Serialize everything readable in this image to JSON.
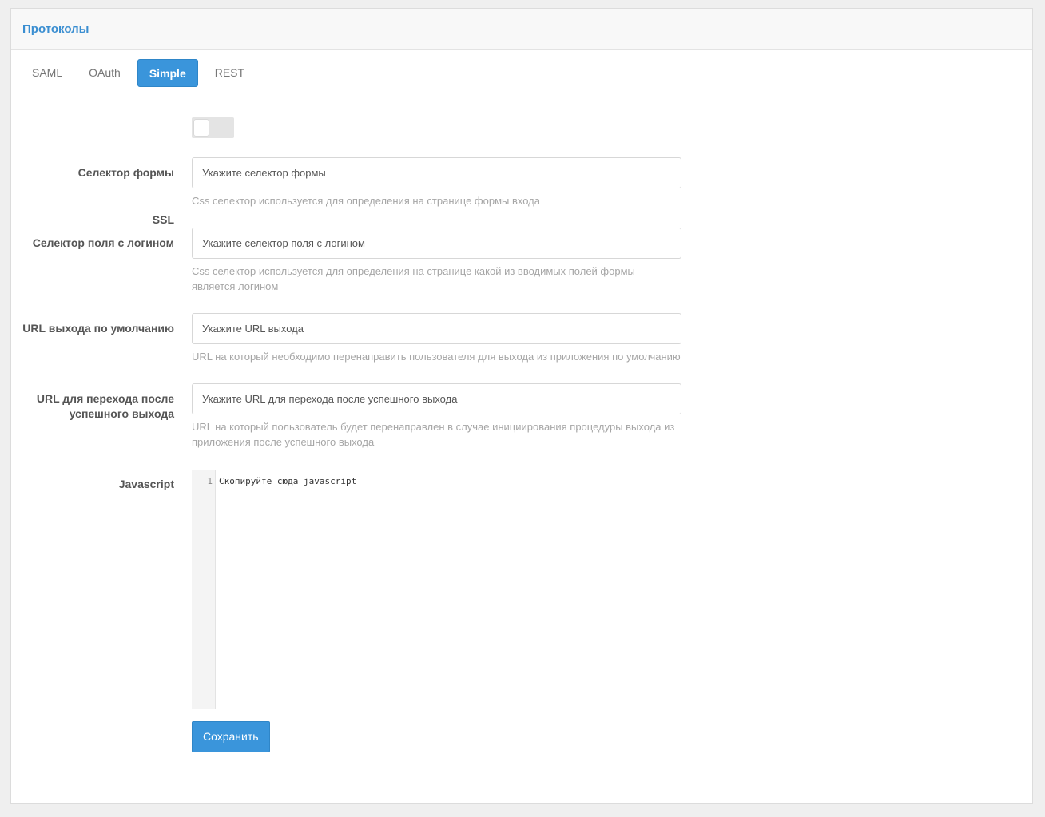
{
  "panel": {
    "title": "Протоколы"
  },
  "tabs": [
    {
      "label": "SAML",
      "active": false
    },
    {
      "label": "OAuth",
      "active": false
    },
    {
      "label": "Simple",
      "active": true
    },
    {
      "label": "REST",
      "active": false
    }
  ],
  "form": {
    "ssl": {
      "label": "SSL",
      "checked": false
    },
    "form_selector": {
      "label": "Селектор формы",
      "placeholder": "Укажите селектор формы",
      "value": "",
      "help": "Css селектор используется для определения на странице формы входа"
    },
    "login_selector": {
      "label": "Селектор поля с логином",
      "placeholder": "Укажите селектор поля с логином",
      "value": "",
      "help": "Css селектор используется для определения на странице какой из вводимых полей формы является логином"
    },
    "logout_url": {
      "label": "URL выхода по умолчанию",
      "placeholder": "Укажите URL выхода",
      "value": "",
      "help": "URL на который необходимо перенаправить пользователя для выхода из приложения по умолчанию"
    },
    "post_logout_url": {
      "label": "URL для перехода после успешного выхода",
      "placeholder": "Укажите URL для перехода после успешного выхода",
      "value": "",
      "help": "URL на который пользователь будет перенаправлен в случае инициирования процедуры выхода из приложения после успешного выхода"
    },
    "javascript": {
      "label": "Javascript",
      "line_number": "1",
      "code": "Скопируйте сюда javascript"
    },
    "save_label": "Сохранить"
  },
  "colors": {
    "accent": "#3a95db",
    "title": "#3a8ed1",
    "help_text": "#a6a6a6"
  }
}
